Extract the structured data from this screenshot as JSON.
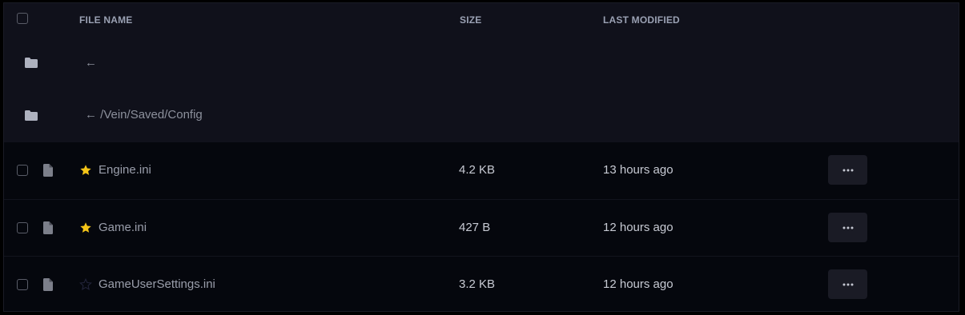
{
  "table": {
    "columns": {
      "name": "FILE NAME",
      "size": "SIZE",
      "modified": "LAST MODIFIED"
    }
  },
  "nav": {
    "back_label": "←",
    "path_label": "← /Vein/Saved/Config"
  },
  "files": [
    {
      "name": "Engine.ini",
      "size": "4.2 KB",
      "modified": "13 hours ago",
      "starred": true
    },
    {
      "name": "Game.ini",
      "size": "427 B",
      "modified": "12 hours ago",
      "starred": true
    },
    {
      "name": "GameUserSettings.ini",
      "size": "3.2 KB",
      "modified": "12 hours ago",
      "starred": false
    }
  ],
  "icons": {
    "folder": "folder-icon",
    "file": "file-icon",
    "star": "star-icon",
    "more": "more-horizontal-icon"
  },
  "colors": {
    "background": "#05070d",
    "header_background": "#10111b",
    "star_active": "#f5c518",
    "star_inactive": "#22243a"
  }
}
